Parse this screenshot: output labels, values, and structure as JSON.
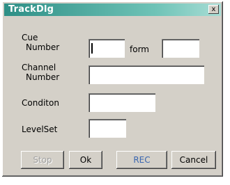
{
  "window": {
    "title": "TrackDlg",
    "close_label": "x"
  },
  "labels": {
    "cue_number_line1": "Cue",
    "cue_number_line2": "Number",
    "form": "form",
    "channel_number_line1": "Channel",
    "channel_number_line2": "Number",
    "condition": "Conditon",
    "level_set": "LevelSet"
  },
  "fields": {
    "cue_number": "",
    "form": "",
    "channel_number": "",
    "condition": "",
    "level_set": ""
  },
  "buttons": {
    "disabled_label": "Stop",
    "ok_label": "Ok",
    "rec_label": "REC",
    "cancel_label": "Cancel"
  }
}
